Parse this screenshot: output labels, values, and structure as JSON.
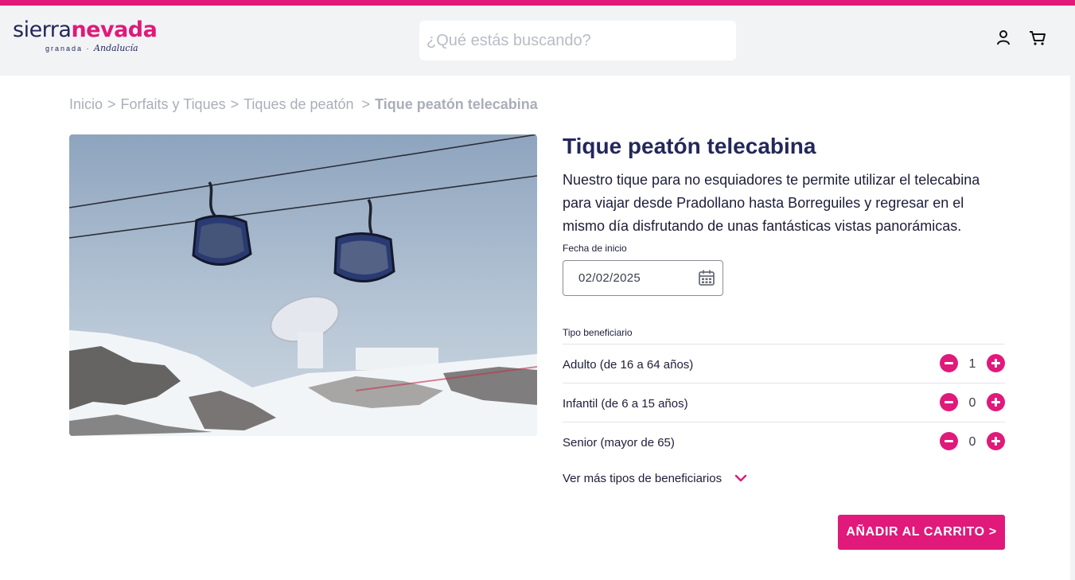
{
  "brand": {
    "name_part1": "sierra",
    "name_part2": "nevada",
    "sub_left": "granada ·",
    "sub_right": "Andalucía",
    "accent": "#e0197a",
    "navy": "#23285a"
  },
  "header": {
    "search_placeholder": "¿Qué estás buscando?",
    "icons": [
      "user-icon",
      "cart-icon"
    ]
  },
  "breadcrumb": {
    "items": [
      "Inicio",
      "Forfaits y Tiques",
      "Tiques de peatón"
    ],
    "separator": ">",
    "current": "Tique peatón telecabina"
  },
  "product": {
    "title": "Tique peatón telecabina",
    "description": "Nuestro tique para no esquiadores te permite utilizar el telecabina para viajar desde Pradollano hasta Borreguiles y regresar en el mismo día disfrutando de unas fantásticas vistas panorámicas.",
    "date_label": "Fecha de inicio",
    "date_value": "02/02/2025",
    "beneficiary_label": "Tipo beneficiario",
    "beneficiaries": [
      {
        "label": "Adulto (de 16 a 64 años)",
        "qty": "1"
      },
      {
        "label": "Infantil (de 6 a 15 años)",
        "qty": "0"
      },
      {
        "label": "Senior (mayor de 65)",
        "qty": "0"
      }
    ],
    "more_label": "Ver más tipos de beneficiarios",
    "cta_label": "AÑADIR AL CARRITO >"
  }
}
